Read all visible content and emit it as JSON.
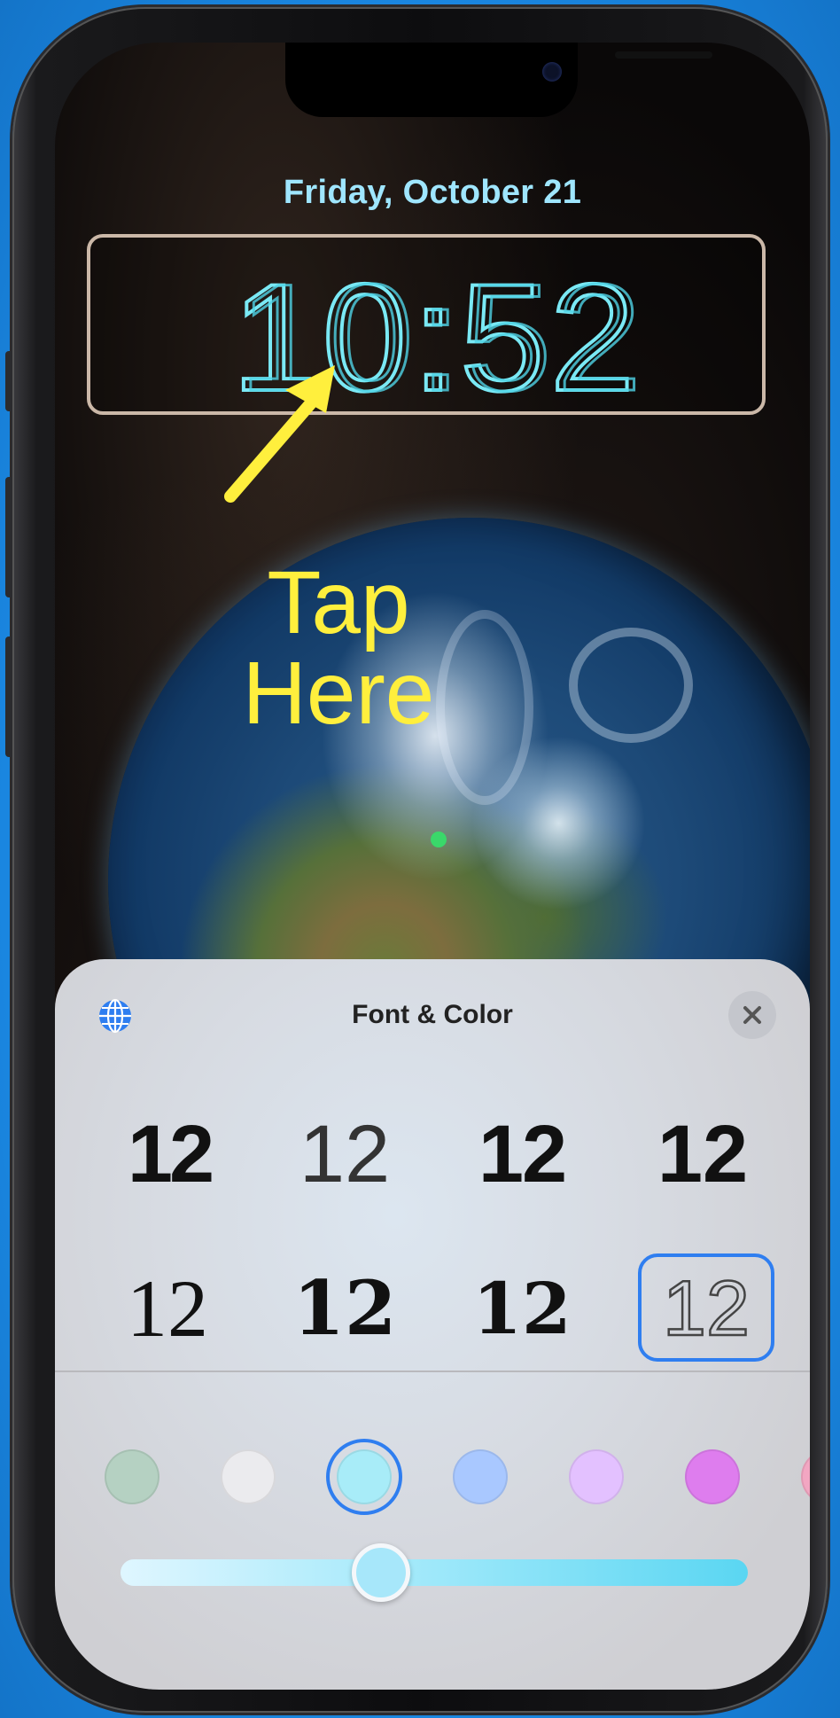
{
  "lock_screen": {
    "date": "Friday, October 21",
    "time": "10:52"
  },
  "annotation": {
    "line1": "Tap",
    "line2": "Here",
    "color": "#ffef3d"
  },
  "font_color_sheet": {
    "title": "Font & Color",
    "globe_icon": "globe-icon",
    "close_icon": "close-icon",
    "font_options": [
      {
        "label": "12",
        "style": "sans-bold"
      },
      {
        "label": "12",
        "style": "sans-thin"
      },
      {
        "label": "12",
        "style": "sans-heavy"
      },
      {
        "label": "12",
        "style": "rounded-bold"
      },
      {
        "label": "12",
        "style": "serif"
      },
      {
        "label": "12",
        "style": "serif-heavy"
      },
      {
        "label": "12",
        "style": "slab"
      },
      {
        "label": "12",
        "style": "stencil-outline"
      }
    ],
    "selected_font_index": 7,
    "colors": [
      "#b5d1c2",
      "#ebebee",
      "#a8ecf8",
      "#a9c8ff",
      "#e3c1ff",
      "#de7dee",
      "#f2a6c2"
    ],
    "selected_color_index": 2,
    "slider_value": 0.5,
    "accent": "#2f7ef0"
  }
}
